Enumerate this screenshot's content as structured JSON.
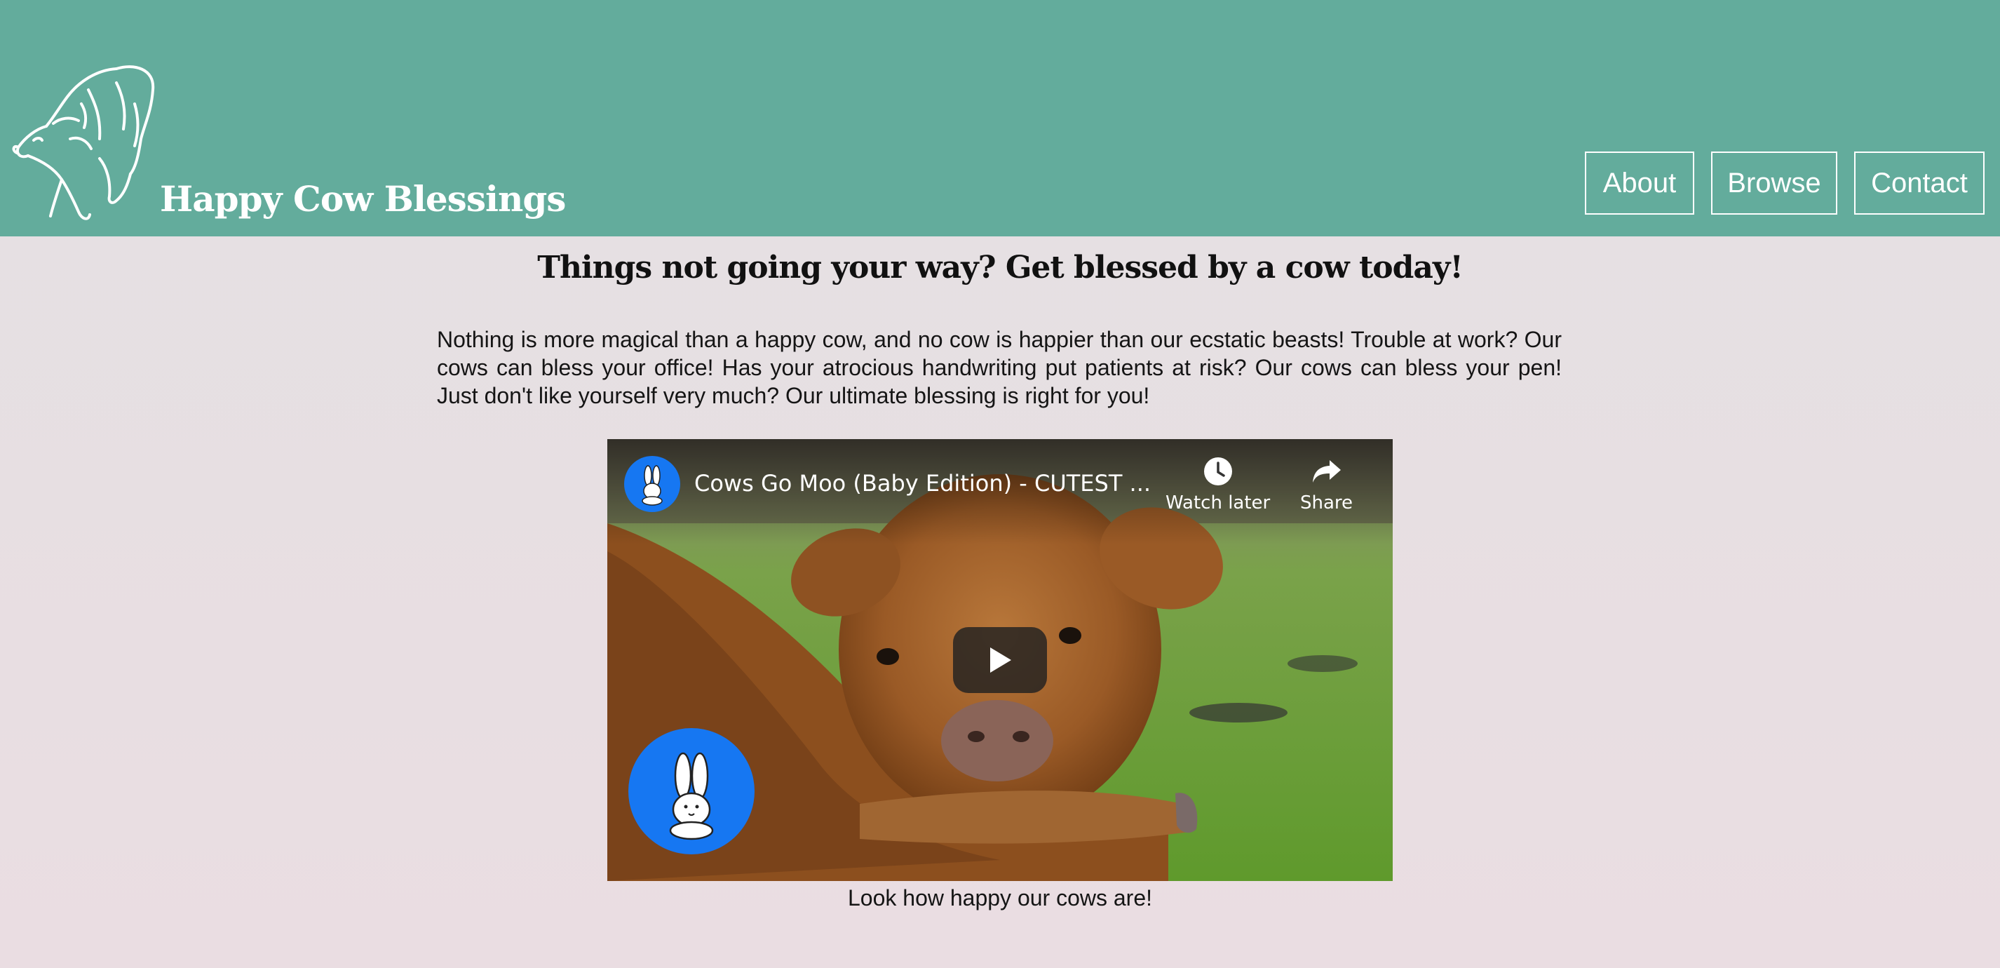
{
  "header": {
    "site_title": "Happy Cow Blessings",
    "logo_icon": "cow-logo-icon",
    "background_color": "#63ac9c",
    "nav": [
      {
        "label": "About"
      },
      {
        "label": "Browse"
      },
      {
        "label": "Contact"
      }
    ]
  },
  "main": {
    "headline": "Things not going your way? Get blessed by a cow today!",
    "intro": "Nothing is more magical than a happy cow, and no cow is happier than our ecstatic beasts! Trouble at work? Our cows can bless your office! Has your atrocious handwriting put patients at risk? Our cows can bless your pen! Just don't like yourself very much? Our ultimate blessing is right for you!",
    "video": {
      "title": "Cows Go Moo (Baby Edition) - CUTEST ...",
      "watch_later_label": "Watch later",
      "share_label": "Share",
      "icons": [
        "clock-icon",
        "share-arrow-icon",
        "play-icon",
        "bunny-avatar-icon"
      ],
      "avatar_color": "#1677f2"
    },
    "caption": "Look how happy our cows are!"
  }
}
